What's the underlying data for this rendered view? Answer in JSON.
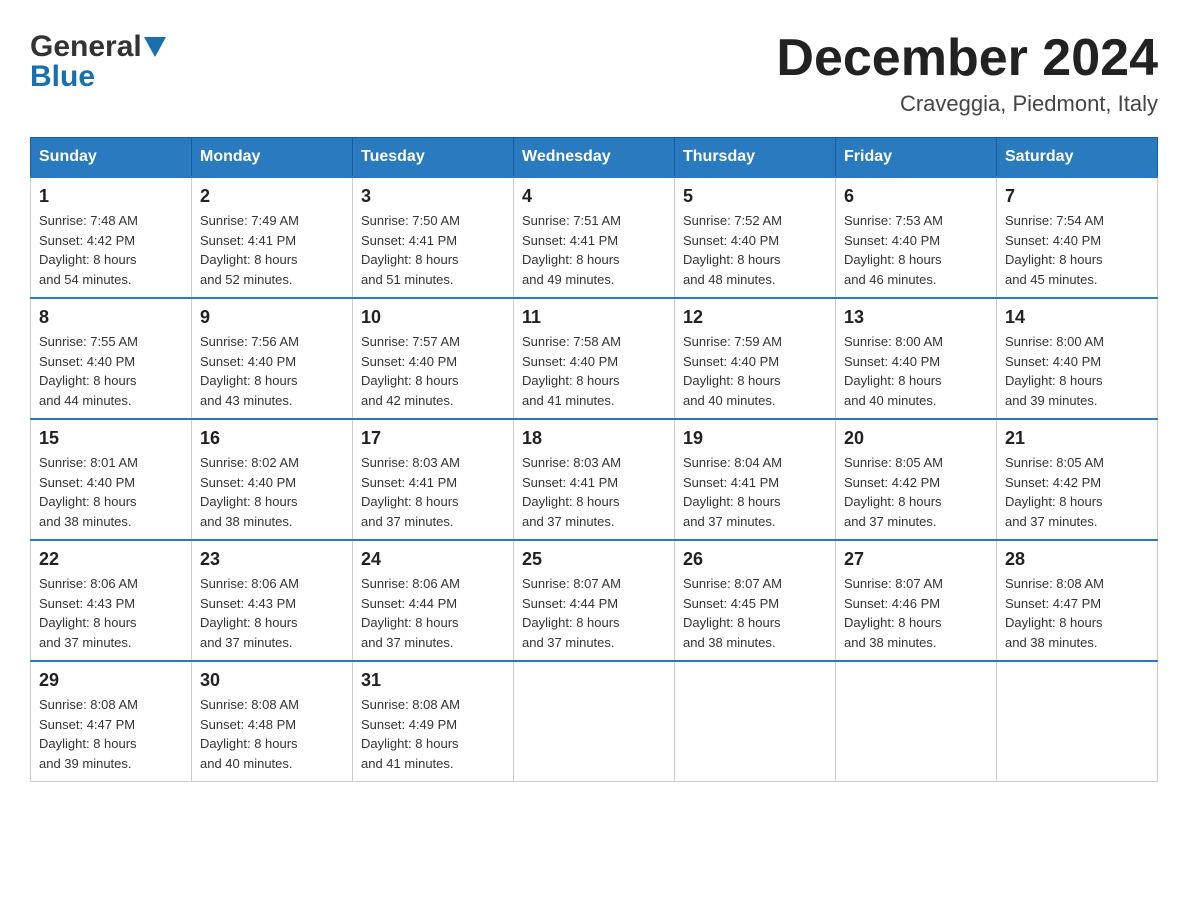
{
  "logo": {
    "name": "General",
    "name2": "Blue"
  },
  "title": "December 2024",
  "subtitle": "Craveggia, Piedmont, Italy",
  "days_of_week": [
    "Sunday",
    "Monday",
    "Tuesday",
    "Wednesday",
    "Thursday",
    "Friday",
    "Saturday"
  ],
  "weeks": [
    [
      {
        "day": "1",
        "sunrise": "7:48 AM",
        "sunset": "4:42 PM",
        "daylight": "8 hours and 54 minutes."
      },
      {
        "day": "2",
        "sunrise": "7:49 AM",
        "sunset": "4:41 PM",
        "daylight": "8 hours and 52 minutes."
      },
      {
        "day": "3",
        "sunrise": "7:50 AM",
        "sunset": "4:41 PM",
        "daylight": "8 hours and 51 minutes."
      },
      {
        "day": "4",
        "sunrise": "7:51 AM",
        "sunset": "4:41 PM",
        "daylight": "8 hours and 49 minutes."
      },
      {
        "day": "5",
        "sunrise": "7:52 AM",
        "sunset": "4:40 PM",
        "daylight": "8 hours and 48 minutes."
      },
      {
        "day": "6",
        "sunrise": "7:53 AM",
        "sunset": "4:40 PM",
        "daylight": "8 hours and 46 minutes."
      },
      {
        "day": "7",
        "sunrise": "7:54 AM",
        "sunset": "4:40 PM",
        "daylight": "8 hours and 45 minutes."
      }
    ],
    [
      {
        "day": "8",
        "sunrise": "7:55 AM",
        "sunset": "4:40 PM",
        "daylight": "8 hours and 44 minutes."
      },
      {
        "day": "9",
        "sunrise": "7:56 AM",
        "sunset": "4:40 PM",
        "daylight": "8 hours and 43 minutes."
      },
      {
        "day": "10",
        "sunrise": "7:57 AM",
        "sunset": "4:40 PM",
        "daylight": "8 hours and 42 minutes."
      },
      {
        "day": "11",
        "sunrise": "7:58 AM",
        "sunset": "4:40 PM",
        "daylight": "8 hours and 41 minutes."
      },
      {
        "day": "12",
        "sunrise": "7:59 AM",
        "sunset": "4:40 PM",
        "daylight": "8 hours and 40 minutes."
      },
      {
        "day": "13",
        "sunrise": "8:00 AM",
        "sunset": "4:40 PM",
        "daylight": "8 hours and 40 minutes."
      },
      {
        "day": "14",
        "sunrise": "8:00 AM",
        "sunset": "4:40 PM",
        "daylight": "8 hours and 39 minutes."
      }
    ],
    [
      {
        "day": "15",
        "sunrise": "8:01 AM",
        "sunset": "4:40 PM",
        "daylight": "8 hours and 38 minutes."
      },
      {
        "day": "16",
        "sunrise": "8:02 AM",
        "sunset": "4:40 PM",
        "daylight": "8 hours and 38 minutes."
      },
      {
        "day": "17",
        "sunrise": "8:03 AM",
        "sunset": "4:41 PM",
        "daylight": "8 hours and 37 minutes."
      },
      {
        "day": "18",
        "sunrise": "8:03 AM",
        "sunset": "4:41 PM",
        "daylight": "8 hours and 37 minutes."
      },
      {
        "day": "19",
        "sunrise": "8:04 AM",
        "sunset": "4:41 PM",
        "daylight": "8 hours and 37 minutes."
      },
      {
        "day": "20",
        "sunrise": "8:05 AM",
        "sunset": "4:42 PM",
        "daylight": "8 hours and 37 minutes."
      },
      {
        "day": "21",
        "sunrise": "8:05 AM",
        "sunset": "4:42 PM",
        "daylight": "8 hours and 37 minutes."
      }
    ],
    [
      {
        "day": "22",
        "sunrise": "8:06 AM",
        "sunset": "4:43 PM",
        "daylight": "8 hours and 37 minutes."
      },
      {
        "day": "23",
        "sunrise": "8:06 AM",
        "sunset": "4:43 PM",
        "daylight": "8 hours and 37 minutes."
      },
      {
        "day": "24",
        "sunrise": "8:06 AM",
        "sunset": "4:44 PM",
        "daylight": "8 hours and 37 minutes."
      },
      {
        "day": "25",
        "sunrise": "8:07 AM",
        "sunset": "4:44 PM",
        "daylight": "8 hours and 37 minutes."
      },
      {
        "day": "26",
        "sunrise": "8:07 AM",
        "sunset": "4:45 PM",
        "daylight": "8 hours and 38 minutes."
      },
      {
        "day": "27",
        "sunrise": "8:07 AM",
        "sunset": "4:46 PM",
        "daylight": "8 hours and 38 minutes."
      },
      {
        "day": "28",
        "sunrise": "8:08 AM",
        "sunset": "4:47 PM",
        "daylight": "8 hours and 38 minutes."
      }
    ],
    [
      {
        "day": "29",
        "sunrise": "8:08 AM",
        "sunset": "4:47 PM",
        "daylight": "8 hours and 39 minutes."
      },
      {
        "day": "30",
        "sunrise": "8:08 AM",
        "sunset": "4:48 PM",
        "daylight": "8 hours and 40 minutes."
      },
      {
        "day": "31",
        "sunrise": "8:08 AM",
        "sunset": "4:49 PM",
        "daylight": "8 hours and 41 minutes."
      },
      null,
      null,
      null,
      null
    ]
  ]
}
